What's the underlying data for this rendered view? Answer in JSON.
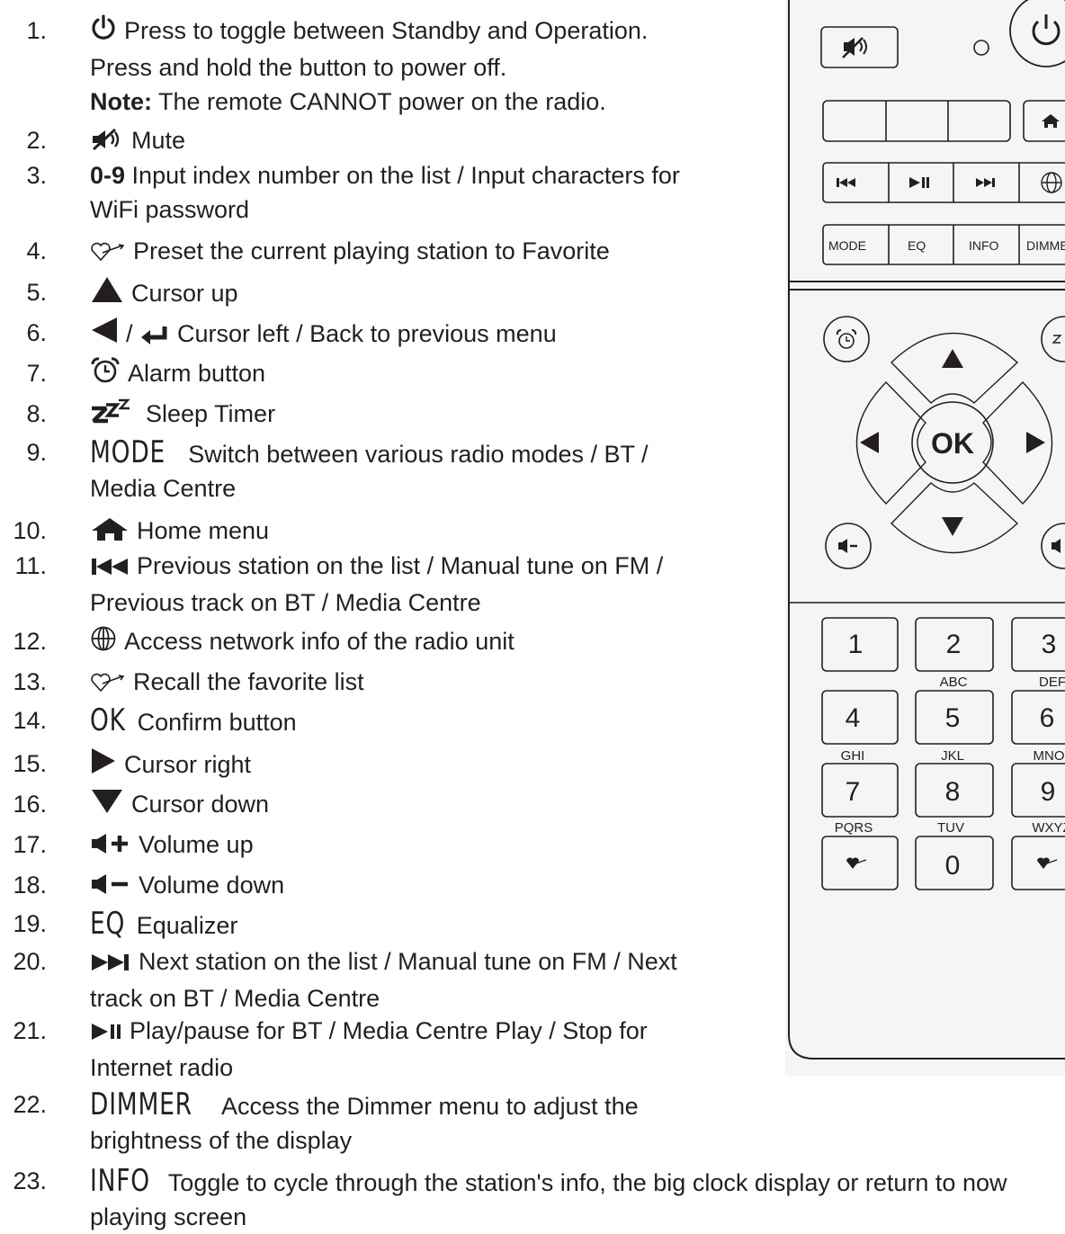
{
  "items": [
    {
      "num": "1.",
      "lines": [
        "Press to toggle between Standby and Operation.",
        "Press and hold the button to power off."
      ],
      "note_label": "Note:",
      "note_text": "The remote CANNOT power on the radio.",
      "icon": "power-icon"
    },
    {
      "num": "2.",
      "text": "Mute",
      "icon": "mute-icon"
    },
    {
      "num": "3.",
      "bold": "0-9",
      "text": "Input index number on the list / Input characters for",
      "text2": "WiFi password"
    },
    {
      "num": "4.",
      "text": "Preset the current playing station to Favorite",
      "icon": "heart-icon"
    },
    {
      "num": "5.",
      "text": "Cursor up",
      "icon": "triangle-up-icon"
    },
    {
      "num": "6.",
      "sep": "/",
      "text": "Cursor left / Back to previous menu",
      "icon": "triangle-left-icon"
    },
    {
      "num": "7.",
      "text": "Alarm button",
      "icon": "alarm-icon"
    },
    {
      "num": "8.",
      "text": "Sleep Timer",
      "icon": "sleep-icon"
    },
    {
      "num": "9.",
      "label": "MODE",
      "text": "Switch between various radio modes / BT /",
      "text2": "Media Centre"
    },
    {
      "num": "10.",
      "text": "Home menu",
      "icon": "home-icon"
    },
    {
      "num": "11.",
      "text": "Previous station on the list / Manual tune on FM /",
      "text2": "Previous track on BT / Media Centre",
      "icon": "previous-icon"
    },
    {
      "num": "12.",
      "text": "Access network info of the radio unit",
      "icon": "globe-icon"
    },
    {
      "num": "13.",
      "text": "Recall the favorite list",
      "icon": "heart-icon"
    },
    {
      "num": "14.",
      "label": "OK",
      "text": "Confirm button"
    },
    {
      "num": "15.",
      "text": "Cursor right",
      "icon": "triangle-right-icon"
    },
    {
      "num": "16.",
      "text": "Cursor down",
      "icon": "triangle-down-icon"
    },
    {
      "num": "17.",
      "text": "Volume up",
      "icon": "volume-up-icon"
    },
    {
      "num": "18.",
      "text": "Volume down",
      "icon": "volume-down-icon"
    },
    {
      "num": "19.",
      "label": "EQ",
      "text": "Equalizer"
    },
    {
      "num": "20.",
      "text": "Next station on the list / Manual tune on FM / Next",
      "text2": "track on BT / Media Centre",
      "icon": "next-icon"
    },
    {
      "num": "21.",
      "text": "Play/pause for BT / Media Centre Play / Stop for",
      "text2": "Internet radio",
      "icon": "play-pause-icon"
    },
    {
      "num": "22.",
      "label": "DIMMER",
      "text": "Access the Dimmer menu to adjust the",
      "text2": "brightness of the display"
    },
    {
      "num": "23.",
      "label": "INFO",
      "text": "Toggle to cycle through the station's info, the big clock display or return to now",
      "text2": "playing screen"
    }
  ],
  "remote": {
    "buttons_row_mode": [
      "MODE",
      "EQ",
      "INFO",
      "DIMME"
    ],
    "ok_label": "OK",
    "keypad": [
      {
        "digit": "1",
        "letters": ""
      },
      {
        "digit": "2",
        "letters": "ABC"
      },
      {
        "digit": "3",
        "letters": "DEF"
      },
      {
        "digit": "4",
        "letters": "GHI"
      },
      {
        "digit": "5",
        "letters": "JKL"
      },
      {
        "digit": "6",
        "letters": "MNO"
      },
      {
        "digit": "7",
        "letters": "PQRS"
      },
      {
        "digit": "8",
        "letters": "TUV"
      },
      {
        "digit": "9",
        "letters": "WXYZ"
      },
      {
        "digit": "0",
        "letters": ""
      }
    ]
  }
}
